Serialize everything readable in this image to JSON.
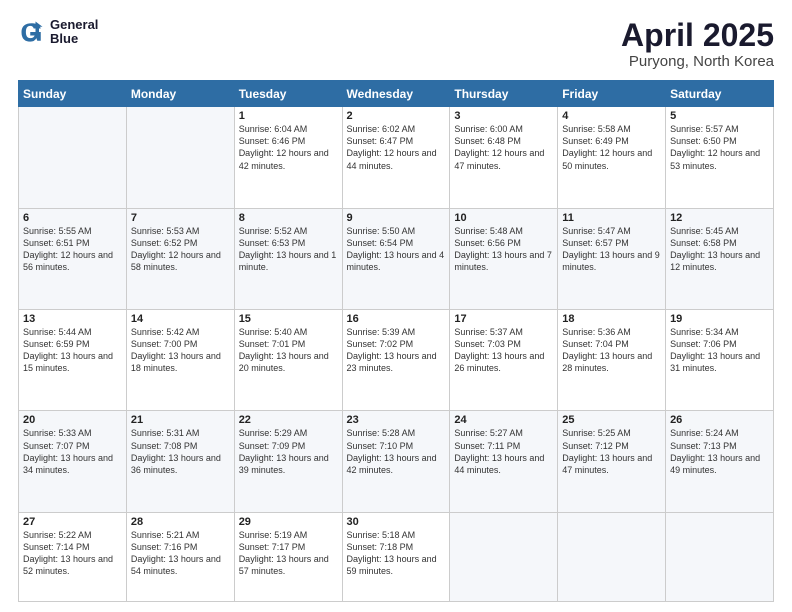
{
  "logo": {
    "line1": "General",
    "line2": "Blue"
  },
  "title": "April 2025",
  "subtitle": "Puryong, North Korea",
  "days_of_week": [
    "Sunday",
    "Monday",
    "Tuesday",
    "Wednesday",
    "Thursday",
    "Friday",
    "Saturday"
  ],
  "weeks": [
    [
      {
        "day": "",
        "sunrise": "",
        "sunset": "",
        "daylight": ""
      },
      {
        "day": "",
        "sunrise": "",
        "sunset": "",
        "daylight": ""
      },
      {
        "day": "1",
        "sunrise": "Sunrise: 6:04 AM",
        "sunset": "Sunset: 6:46 PM",
        "daylight": "Daylight: 12 hours and 42 minutes."
      },
      {
        "day": "2",
        "sunrise": "Sunrise: 6:02 AM",
        "sunset": "Sunset: 6:47 PM",
        "daylight": "Daylight: 12 hours and 44 minutes."
      },
      {
        "day": "3",
        "sunrise": "Sunrise: 6:00 AM",
        "sunset": "Sunset: 6:48 PM",
        "daylight": "Daylight: 12 hours and 47 minutes."
      },
      {
        "day": "4",
        "sunrise": "Sunrise: 5:58 AM",
        "sunset": "Sunset: 6:49 PM",
        "daylight": "Daylight: 12 hours and 50 minutes."
      },
      {
        "day": "5",
        "sunrise": "Sunrise: 5:57 AM",
        "sunset": "Sunset: 6:50 PM",
        "daylight": "Daylight: 12 hours and 53 minutes."
      }
    ],
    [
      {
        "day": "6",
        "sunrise": "Sunrise: 5:55 AM",
        "sunset": "Sunset: 6:51 PM",
        "daylight": "Daylight: 12 hours and 56 minutes."
      },
      {
        "day": "7",
        "sunrise": "Sunrise: 5:53 AM",
        "sunset": "Sunset: 6:52 PM",
        "daylight": "Daylight: 12 hours and 58 minutes."
      },
      {
        "day": "8",
        "sunrise": "Sunrise: 5:52 AM",
        "sunset": "Sunset: 6:53 PM",
        "daylight": "Daylight: 13 hours and 1 minute."
      },
      {
        "day": "9",
        "sunrise": "Sunrise: 5:50 AM",
        "sunset": "Sunset: 6:54 PM",
        "daylight": "Daylight: 13 hours and 4 minutes."
      },
      {
        "day": "10",
        "sunrise": "Sunrise: 5:48 AM",
        "sunset": "Sunset: 6:56 PM",
        "daylight": "Daylight: 13 hours and 7 minutes."
      },
      {
        "day": "11",
        "sunrise": "Sunrise: 5:47 AM",
        "sunset": "Sunset: 6:57 PM",
        "daylight": "Daylight: 13 hours and 9 minutes."
      },
      {
        "day": "12",
        "sunrise": "Sunrise: 5:45 AM",
        "sunset": "Sunset: 6:58 PM",
        "daylight": "Daylight: 13 hours and 12 minutes."
      }
    ],
    [
      {
        "day": "13",
        "sunrise": "Sunrise: 5:44 AM",
        "sunset": "Sunset: 6:59 PM",
        "daylight": "Daylight: 13 hours and 15 minutes."
      },
      {
        "day": "14",
        "sunrise": "Sunrise: 5:42 AM",
        "sunset": "Sunset: 7:00 PM",
        "daylight": "Daylight: 13 hours and 18 minutes."
      },
      {
        "day": "15",
        "sunrise": "Sunrise: 5:40 AM",
        "sunset": "Sunset: 7:01 PM",
        "daylight": "Daylight: 13 hours and 20 minutes."
      },
      {
        "day": "16",
        "sunrise": "Sunrise: 5:39 AM",
        "sunset": "Sunset: 7:02 PM",
        "daylight": "Daylight: 13 hours and 23 minutes."
      },
      {
        "day": "17",
        "sunrise": "Sunrise: 5:37 AM",
        "sunset": "Sunset: 7:03 PM",
        "daylight": "Daylight: 13 hours and 26 minutes."
      },
      {
        "day": "18",
        "sunrise": "Sunrise: 5:36 AM",
        "sunset": "Sunset: 7:04 PM",
        "daylight": "Daylight: 13 hours and 28 minutes."
      },
      {
        "day": "19",
        "sunrise": "Sunrise: 5:34 AM",
        "sunset": "Sunset: 7:06 PM",
        "daylight": "Daylight: 13 hours and 31 minutes."
      }
    ],
    [
      {
        "day": "20",
        "sunrise": "Sunrise: 5:33 AM",
        "sunset": "Sunset: 7:07 PM",
        "daylight": "Daylight: 13 hours and 34 minutes."
      },
      {
        "day": "21",
        "sunrise": "Sunrise: 5:31 AM",
        "sunset": "Sunset: 7:08 PM",
        "daylight": "Daylight: 13 hours and 36 minutes."
      },
      {
        "day": "22",
        "sunrise": "Sunrise: 5:29 AM",
        "sunset": "Sunset: 7:09 PM",
        "daylight": "Daylight: 13 hours and 39 minutes."
      },
      {
        "day": "23",
        "sunrise": "Sunrise: 5:28 AM",
        "sunset": "Sunset: 7:10 PM",
        "daylight": "Daylight: 13 hours and 42 minutes."
      },
      {
        "day": "24",
        "sunrise": "Sunrise: 5:27 AM",
        "sunset": "Sunset: 7:11 PM",
        "daylight": "Daylight: 13 hours and 44 minutes."
      },
      {
        "day": "25",
        "sunrise": "Sunrise: 5:25 AM",
        "sunset": "Sunset: 7:12 PM",
        "daylight": "Daylight: 13 hours and 47 minutes."
      },
      {
        "day": "26",
        "sunrise": "Sunrise: 5:24 AM",
        "sunset": "Sunset: 7:13 PM",
        "daylight": "Daylight: 13 hours and 49 minutes."
      }
    ],
    [
      {
        "day": "27",
        "sunrise": "Sunrise: 5:22 AM",
        "sunset": "Sunset: 7:14 PM",
        "daylight": "Daylight: 13 hours and 52 minutes."
      },
      {
        "day": "28",
        "sunrise": "Sunrise: 5:21 AM",
        "sunset": "Sunset: 7:16 PM",
        "daylight": "Daylight: 13 hours and 54 minutes."
      },
      {
        "day": "29",
        "sunrise": "Sunrise: 5:19 AM",
        "sunset": "Sunset: 7:17 PM",
        "daylight": "Daylight: 13 hours and 57 minutes."
      },
      {
        "day": "30",
        "sunrise": "Sunrise: 5:18 AM",
        "sunset": "Sunset: 7:18 PM",
        "daylight": "Daylight: 13 hours and 59 minutes."
      },
      {
        "day": "",
        "sunrise": "",
        "sunset": "",
        "daylight": ""
      },
      {
        "day": "",
        "sunrise": "",
        "sunset": "",
        "daylight": ""
      },
      {
        "day": "",
        "sunrise": "",
        "sunset": "",
        "daylight": ""
      }
    ]
  ]
}
